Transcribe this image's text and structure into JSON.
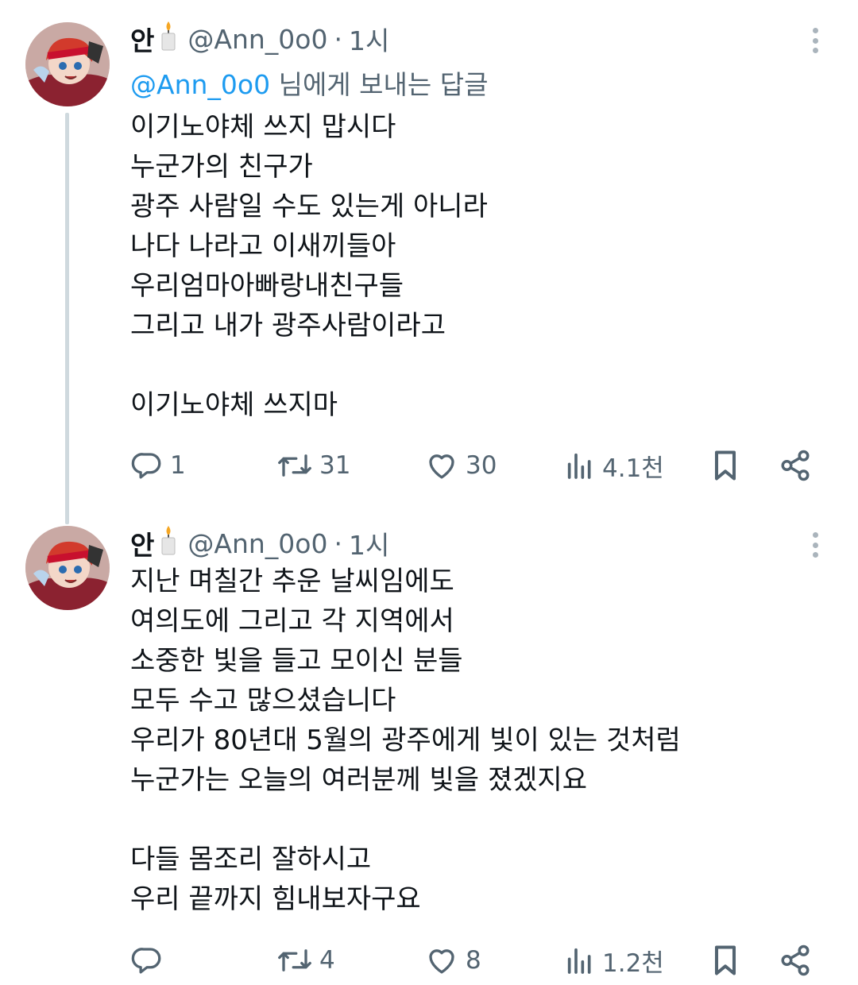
{
  "tweets": [
    {
      "author_name": "안",
      "handle": "@Ann_0o0",
      "separator": "·",
      "time": "1시",
      "replying_to_mention": "@Ann_0o0",
      "replying_to_suffix": " 님에게 보내는 답글",
      "body": "이기노야체 쓰지 맙시다\n누군가의 친구가\n광주 사람일 수도 있는게 아니라\n나다 나라고 이새끼들아\n우리엄마아빠랑내친구들\n그리고 내가 광주사람이라고\n\n이기노야체 쓰지마",
      "replies": "1",
      "retweets": "31",
      "likes": "30",
      "views": "4.1천"
    },
    {
      "author_name": "안",
      "handle": "@Ann_0o0",
      "separator": "·",
      "time": "1시",
      "body": "지난 며칠간 추운 날씨임에도\n여의도에 그리고 각 지역에서\n소중한 빛을 들고 모이신 분들\n모두 수고 많으셨습니다\n우리가 80년대 5월의 광주에게 빛이 있는 것처럼\n누군가는 오늘의 여러분께 빛을 졌겠지요\n\n다들 몸조리 잘하시고\n우리 끝까지 힘내보자구요",
      "replies": "",
      "retweets": "4",
      "likes": "8",
      "views": "1.2천"
    }
  ],
  "icons": {
    "candle": "candle-emoji",
    "reply": "reply-icon",
    "retweet": "retweet-icon",
    "like": "heart-icon",
    "views": "views-icon",
    "bookmark": "bookmark-icon",
    "share": "share-icon",
    "more": "more-options-icon"
  },
  "colors": {
    "text": "#0f1419",
    "secondary": "#536471",
    "link": "#1d9bf0",
    "thread_line": "#cfd9de"
  }
}
